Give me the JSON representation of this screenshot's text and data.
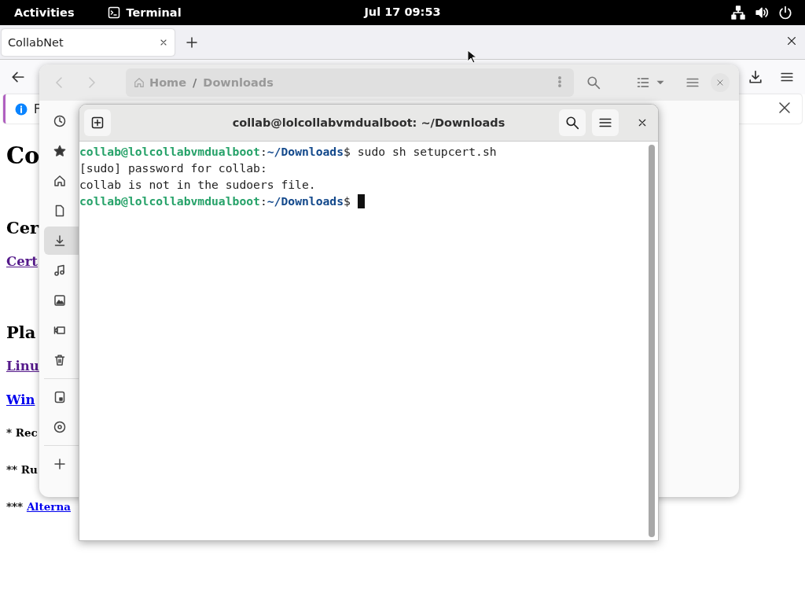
{
  "top_bar": {
    "activities": "Activities",
    "app_name": "Terminal",
    "clock": "Jul 17  09:53"
  },
  "browser": {
    "tab": {
      "label": "CollabNet",
      "selected": true
    },
    "info_bar": {
      "text": "F"
    },
    "content": [
      {
        "kind": "h1",
        "text": "Co"
      },
      {
        "kind": "h2",
        "text": "Cer"
      },
      {
        "kind": "link",
        "text": "Cert",
        "visited": true
      },
      {
        "kind": "h2",
        "text": "Pla"
      },
      {
        "kind": "link",
        "text": "Linu",
        "visited": true
      },
      {
        "kind": "link",
        "text": "Win",
        "visited": false
      },
      {
        "kind": "note",
        "text": "* Rec"
      },
      {
        "kind": "note",
        "text": "** Ru"
      },
      {
        "kind": "note",
        "text": "*** ",
        "link": "Alterna",
        "visited": false
      }
    ]
  },
  "file_manager": {
    "path": [
      "Home",
      "Downloads"
    ],
    "path_separator": "/",
    "sidebar_groups": [
      [
        {
          "selected": false
        },
        {
          "selected": false
        },
        {
          "selected": false
        },
        {
          "selected": false
        },
        {
          "selected": true
        },
        {
          "selected": false
        },
        {
          "selected": false
        },
        {
          "selected": false
        },
        {
          "selected": false
        }
      ],
      [
        {
          "selected": false
        },
        {
          "selected": false
        }
      ],
      [
        {
          "selected": false
        }
      ]
    ]
  },
  "terminal": {
    "title": "collab@lolcollabvmdualboot: ~/Downloads",
    "lines": [
      {
        "kind": "prompt",
        "user_host": "collab@lolcollabvmdualboot",
        "sep": ":",
        "path": "~/Downloads",
        "sign": "$",
        "command": "sudo sh setupcert.sh",
        "cursor": false
      },
      {
        "kind": "output",
        "text": "[sudo] password for collab:"
      },
      {
        "kind": "output",
        "text": "collab is not in the sudoers file."
      },
      {
        "kind": "prompt",
        "user_host": "collab@lolcollabvmdualboot",
        "sep": ":",
        "path": "~/Downloads",
        "sign": "$",
        "cursor": true
      }
    ]
  }
}
